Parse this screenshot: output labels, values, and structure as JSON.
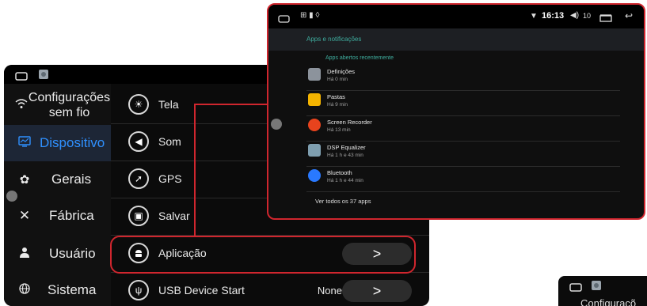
{
  "colors": {
    "accent": "#2f90ff",
    "highlight": "#d0262e",
    "section": "#3fae9f"
  },
  "sidebar": {
    "items": [
      {
        "label": "Configurações sem fio",
        "icon": "wifi-icon"
      },
      {
        "label": "Dispositivo",
        "icon": "monitor-icon",
        "active": true
      },
      {
        "label": "Gerais",
        "icon": "gear-icon"
      },
      {
        "label": "Fábrica",
        "icon": "tools-icon"
      },
      {
        "label": "Usuário",
        "icon": "user-icon"
      },
      {
        "label": "Sistema",
        "icon": "globe-icon"
      }
    ]
  },
  "settings": {
    "items": [
      {
        "label": "Tela",
        "icon": "brightness-icon"
      },
      {
        "label": "Som",
        "icon": "speaker-icon"
      },
      {
        "label": "GPS",
        "icon": "satellite-icon"
      },
      {
        "label": "Salvar",
        "icon": "save-icon"
      },
      {
        "label": "Aplicação",
        "icon": "android-icon",
        "button": ">"
      },
      {
        "label": "USB Device Start",
        "icon": "usb-icon",
        "value": "None",
        "button": ">"
      }
    ]
  },
  "popup": {
    "status": {
      "time": "16:13",
      "volume": "10"
    },
    "title": "Apps e notificações",
    "section": "Apps abertos recentemente",
    "apps": [
      {
        "name": "Definições",
        "time": "Há 0 min",
        "icon": "settings-app-icon",
        "color": "#8c939c"
      },
      {
        "name": "Pastas",
        "time": "Há 9 min",
        "icon": "folder-app-icon",
        "color": "#f4b400"
      },
      {
        "name": "Screen Recorder",
        "time": "Há 13 min",
        "icon": "recorder-app-icon",
        "color": "#e8431d"
      },
      {
        "name": "DSP Equalizer",
        "time": "Há 1 h e 43 min",
        "icon": "equalizer-app-icon",
        "color": "#7f9fb0"
      },
      {
        "name": "Bluetooth",
        "time": "Há 1 h e 44 min",
        "icon": "bluetooth-app-icon",
        "color": "#2979ff"
      }
    ],
    "see_all": "Ver todos os 37 apps"
  },
  "mini_preview": {
    "label": "Configuraçõ"
  }
}
